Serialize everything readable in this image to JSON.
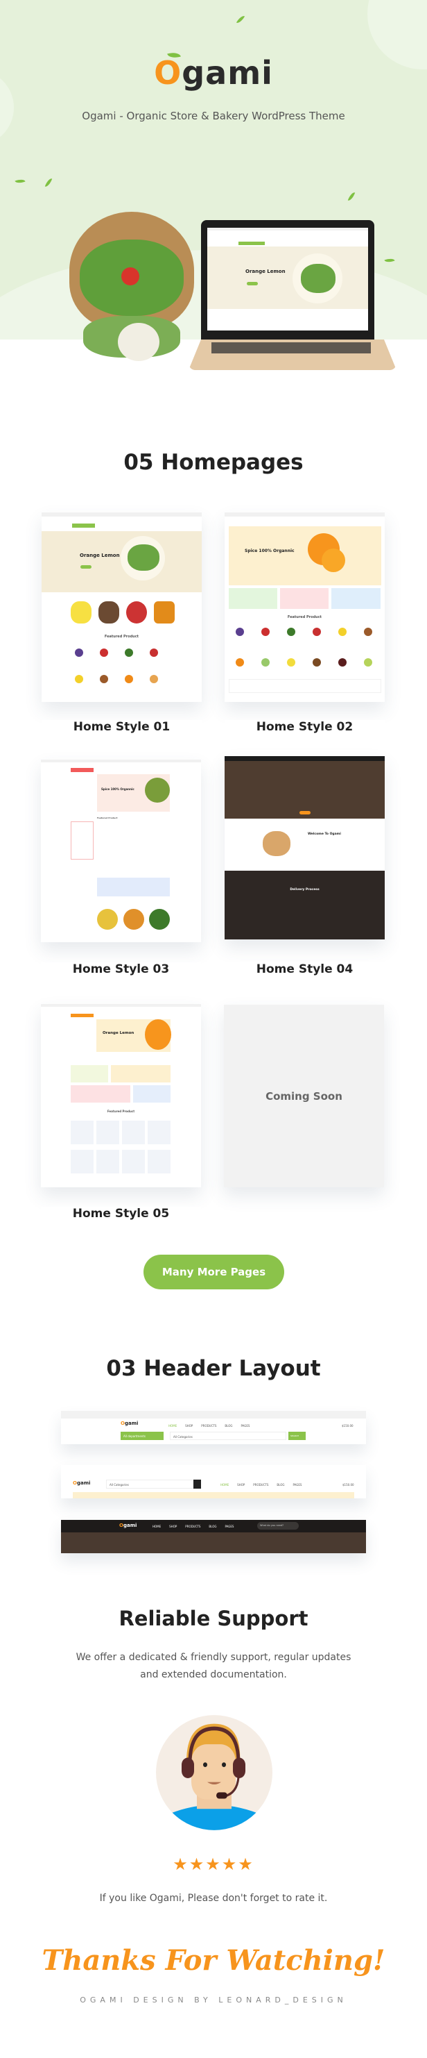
{
  "hero": {
    "logo_text": "Ogami",
    "subtitle": "Ogami - Organic Store & Bakery WordPress Theme",
    "laptop_screen_heading": "Orange Lemon"
  },
  "homepages": {
    "title": "05 Homepages",
    "items": [
      {
        "label": "Home Style 01",
        "preview_heading": "Orange Lemon",
        "preview_section": "Featured Product"
      },
      {
        "label": "Home Style 02",
        "preview_heading": "Spice 100% Organnic",
        "preview_section": "Featured Product"
      },
      {
        "label": "Home Style 03",
        "preview_heading": "Spice 100% Organnic",
        "preview_section": "Featured Product"
      },
      {
        "label": "Home Style 04",
        "preview_heading": "Welcome To Ogami",
        "preview_section": "Delivery Process"
      },
      {
        "label": "Home Style 05",
        "preview_heading": "Orange Lemon",
        "preview_section": "Featured Product"
      }
    ],
    "coming_soon": "Coming Soon",
    "more_button": "Many More Pages"
  },
  "headers": {
    "title": "03 Header Layout",
    "nav": [
      "HOME",
      "SHOP",
      "PRODUCTS",
      "BLOG",
      "PAGES"
    ],
    "search_placeholder": "What do you need?",
    "categories": "All Categories",
    "departments": "All departments",
    "cart_total": "$150.00",
    "search_button": "SEARCH"
  },
  "support": {
    "title": "Reliable Support",
    "line1": "We offer a dedicated & friendly support, regular updates",
    "line2": "and extended documentation.",
    "rating": 5,
    "rate_text": "If you like Ogami, Please don't forget to rate it."
  },
  "footer": {
    "thanks": "Thanks For Watching!",
    "credit": "OGAMI DESIGN BY LEONARD_DESIGN"
  },
  "colors": {
    "green": "#8bc34a",
    "orange": "#f7941d",
    "hero_bg": "#e5f1da"
  }
}
